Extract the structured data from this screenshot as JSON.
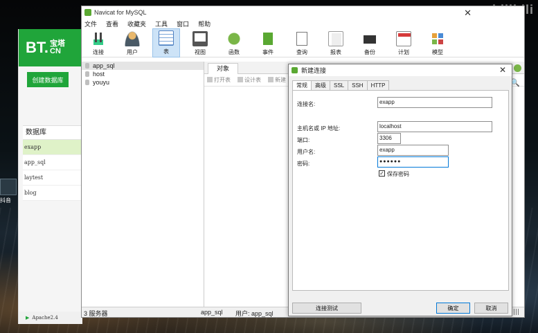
{
  "watermark": "bilibili",
  "desktop": {
    "icon_label": "抖音"
  },
  "bt": {
    "logo_main": "BT.",
    "logo_cn_top": "宝塔",
    "logo_cn_bottom": "CN",
    "create_button": "创建数据库",
    "list_header": "数据库",
    "databases": [
      "exapp",
      "app_sql",
      "laytest",
      "blog"
    ],
    "bottom_service": "Apache2.4"
  },
  "navicat": {
    "title": "Navicat for MySQL",
    "menu": [
      "文件",
      "查看",
      "收藏夹",
      "工具",
      "窗口",
      "帮助"
    ],
    "toolbar": [
      {
        "label": "连接",
        "icon": "connection-icon"
      },
      {
        "label": "用户",
        "icon": "user-icon"
      },
      {
        "label": "表",
        "icon": "table-icon",
        "active": true
      },
      {
        "label": "视图",
        "icon": "view-icon"
      },
      {
        "label": "函数",
        "icon": "function-icon"
      },
      {
        "label": "事件",
        "icon": "event-icon"
      },
      {
        "label": "查询",
        "icon": "query-icon"
      },
      {
        "label": "报表",
        "icon": "report-icon"
      },
      {
        "label": "备份",
        "icon": "backup-icon"
      },
      {
        "label": "计划",
        "icon": "schedule-icon"
      },
      {
        "label": "模型",
        "icon": "model-icon"
      }
    ],
    "tree": [
      "app_sql",
      "host",
      "youyu"
    ],
    "object_tab": "对象",
    "object_toolbar": [
      "打开表",
      "设计表",
      "新建"
    ],
    "status": {
      "servers": "3 服务器",
      "connection": "app_sql",
      "user": "用户: app_sql"
    }
  },
  "dialog": {
    "title": "新建连接",
    "tabs": [
      "常规",
      "高级",
      "SSL",
      "SSH",
      "HTTP"
    ],
    "labels": {
      "conn_name": "连接名:",
      "host": "主机名或 IP 地址:",
      "port": "端口:",
      "username": "用户名:",
      "password": "密码:"
    },
    "values": {
      "conn_name": "exapp",
      "host": "localhost",
      "port": "3306",
      "username": "exapp",
      "password": "●●●●●●"
    },
    "save_password_label": "保存密码",
    "save_password_checked": "✓",
    "buttons": {
      "test": "连接测试",
      "ok": "确定",
      "cancel": "取消"
    }
  }
}
